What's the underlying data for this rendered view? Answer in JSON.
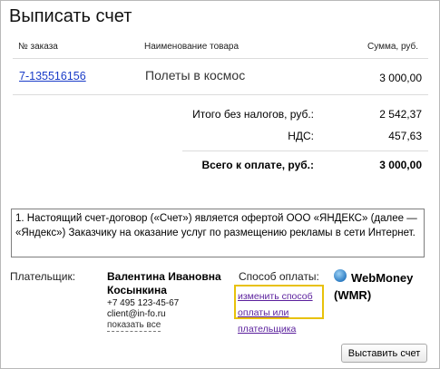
{
  "page": {
    "title": "Выписать счет"
  },
  "table": {
    "headers": {
      "order_no": "№ заказа",
      "product": "Наименование товара",
      "sum": "Сумма, руб."
    },
    "rows": [
      {
        "order_no": "7-135516156",
        "product": "Полеты в космос",
        "sum": "3 000,00"
      }
    ]
  },
  "totals": {
    "without_tax_label": "Итого без налогов, руб.:",
    "without_tax_value": "2 542,37",
    "vat_label": "НДС:",
    "vat_value": "457,63",
    "total_label": "Всего к оплате, руб.:",
    "total_value": "3 000,00"
  },
  "contract_text": "1.    Настоящий счет-договор («Счет») является офертой ООО «ЯНДЕКС» (далее — «Яндекс») Заказчику на оказание услуг по размещению рекламы в сети Интернет.",
  "payer": {
    "label": "Плательщик:",
    "name": "Валентина Ивановна Косынкина",
    "phone": "+7 495 123-45-67",
    "email": "client@in-fo.ru",
    "show_all": "показать все"
  },
  "payment": {
    "label": "Способ оплаты:",
    "change_link": "изменить способ оплаты или плательщика",
    "method_name": "WebMoney",
    "method_code": "(WMR)",
    "icon": "webmoney-globe-icon"
  },
  "actions": {
    "submit_label": "Выставить счет"
  },
  "colors": {
    "link": "#1a3cc8",
    "visited_link": "#5a1f9c",
    "highlight": "#e8c10a"
  }
}
